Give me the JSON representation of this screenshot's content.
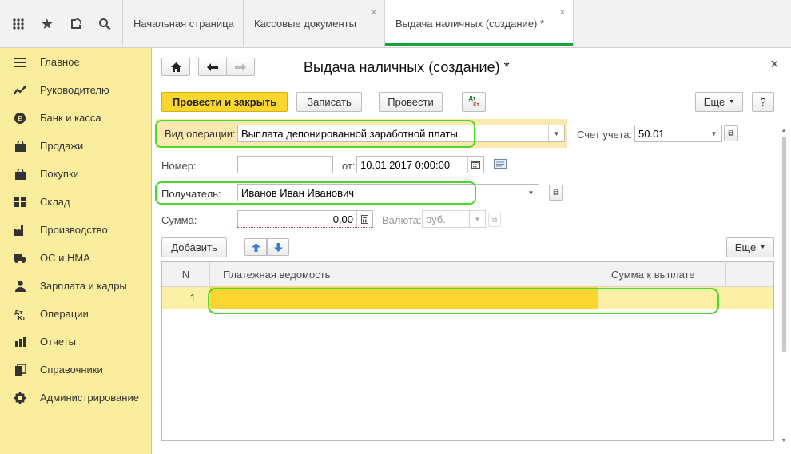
{
  "tabs": [
    {
      "label": "Начальная страница"
    },
    {
      "label": "Кассовые документы",
      "close": "×"
    },
    {
      "label": "Выдача наличных (создание) *",
      "close": "×"
    }
  ],
  "sidebar": {
    "items": [
      {
        "label": "Главное",
        "icon": "menu-icon"
      },
      {
        "label": "Руководителю",
        "icon": "trend-icon"
      },
      {
        "label": "Банк и касса",
        "icon": "ruble-icon"
      },
      {
        "label": "Продажи",
        "icon": "bag-icon"
      },
      {
        "label": "Покупки",
        "icon": "cart-icon"
      },
      {
        "label": "Склад",
        "icon": "warehouse-icon"
      },
      {
        "label": "Производство",
        "icon": "factory-icon"
      },
      {
        "label": "ОС и НМА",
        "icon": "truck-icon"
      },
      {
        "label": "Зарплата и кадры",
        "icon": "people-icon"
      },
      {
        "label": "Операции",
        "icon": "dt-kt-icon"
      },
      {
        "label": "Отчеты",
        "icon": "barchart-icon"
      },
      {
        "label": "Справочники",
        "icon": "books-icon"
      },
      {
        "label": "Администрирование",
        "icon": "gear-icon"
      }
    ]
  },
  "form": {
    "title": "Выдача наличных (создание) *",
    "close": "×",
    "buttons": {
      "post_close": "Провести и закрыть",
      "save": "Записать",
      "post": "Провести",
      "more": "Еще",
      "help": "?",
      "dtkt_top": "Дт",
      "dtkt_bottom": "Кт"
    },
    "operation_label": "Вид операции:",
    "operation_value": "Выплата депонированной заработной платы",
    "account_label": "Счет учета:",
    "account_value": "50.01",
    "number_label": "Номер:",
    "number_value": "",
    "date_label": "от:",
    "date_value": "10.01.2017  0:00:00",
    "recipient_label": "Получатель:",
    "recipient_value": "Иванов Иван Иванович",
    "amount_label": "Сумма:",
    "amount_value": "0,00",
    "currency_label": "Валюта:",
    "currency_value": "руб.",
    "add_button": "Добавить",
    "table_more": "Еще",
    "table": {
      "columns": [
        "N",
        "Платежная ведомость",
        "Сумма к выплате"
      ],
      "rows": [
        {
          "n": "1",
          "statement": "",
          "amount": ""
        }
      ]
    }
  },
  "colors": {
    "sidebar": "#fbed9e",
    "accent_button": "#fbd62e",
    "selected_row": "#fbd62e",
    "highlight_box": "#4cd829",
    "active_tab": "#1b9e3e"
  }
}
